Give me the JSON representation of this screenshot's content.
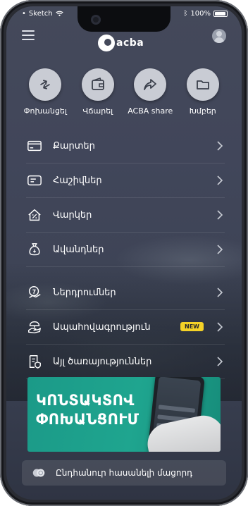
{
  "status_bar": {
    "carrier": "Sketch",
    "battery_percent": "100%"
  },
  "header": {
    "logo_text": "acba"
  },
  "quick_actions": [
    {
      "label": "Փոխանցել",
      "icon": "transfer-arrows-icon"
    },
    {
      "label": "Վճարել",
      "icon": "wallet-icon"
    },
    {
      "label": "ACBA share",
      "icon": "share-icon"
    },
    {
      "label": "Խմբեր",
      "icon": "folder-icon"
    }
  ],
  "menu": [
    {
      "label": "Քարտեր",
      "icon": "card-icon"
    },
    {
      "label": "Հաշիվներ",
      "icon": "account-icon"
    },
    {
      "label": "Վարկեր",
      "icon": "home-percent-icon"
    },
    {
      "label": "Ավանդներ",
      "icon": "money-bag-icon"
    },
    {
      "label": "Ներդրումներ",
      "icon": "investment-icon"
    },
    {
      "label": "Ապահովագրություն",
      "icon": "insurance-icon",
      "badge": "NEW"
    },
    {
      "label": "Այլ ծառայություններ",
      "icon": "services-icon"
    }
  ],
  "banner": {
    "line1": "ԿՈՆՏԱԿՏՈՎ",
    "line2": "ՓՈԽԱՆՑՈՒՄ"
  },
  "bottom_action": {
    "label": "Ընդհանուր հասանելի մացորդ",
    "icon": "coins-icon"
  },
  "colors": {
    "badge": "#f5d227",
    "banner": "#1fa58f",
    "background": "#41465a"
  }
}
